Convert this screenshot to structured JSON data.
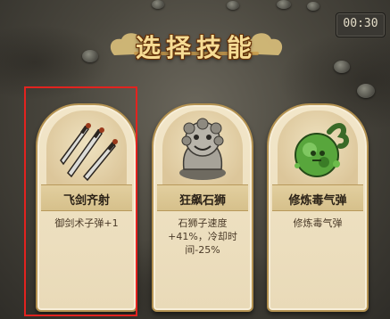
{
  "title": "选择技能",
  "timer": "00:30",
  "cards": [
    {
      "name": "飞剑齐射",
      "desc": "御剑术子弹+1",
      "icon": "flying-swords-icon"
    },
    {
      "name": "狂飙石狮",
      "desc": "石狮子速度+41%，冷却时间-25%",
      "icon": "stone-lion-icon"
    },
    {
      "name": "修炼毒气弹",
      "desc": "修炼毒气弹",
      "icon": "poison-gas-bomb-icon"
    }
  ],
  "selected_index": 0,
  "colors": {
    "highlight": "#e2231f",
    "card": "#f0e4c6",
    "title": "#f6dc94"
  }
}
